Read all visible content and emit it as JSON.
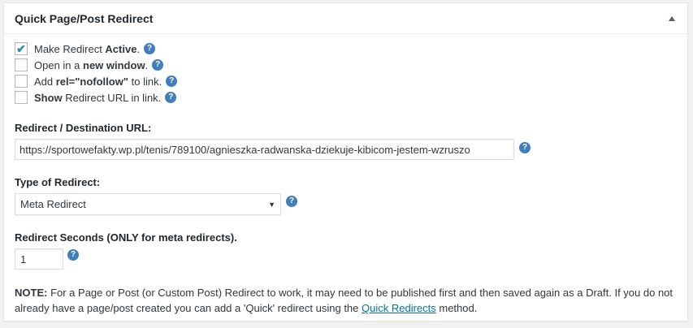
{
  "box": {
    "title": "Quick Page/Post Redirect"
  },
  "options": [
    {
      "checked": true,
      "pre": "Make Redirect ",
      "bold": "Active",
      "post": "."
    },
    {
      "checked": false,
      "pre": "Open in a ",
      "bold": "new window",
      "post": "."
    },
    {
      "checked": false,
      "pre": "Add ",
      "bold": "rel=\"nofollow\"",
      "post": " to link."
    },
    {
      "checked": false,
      "pre": "",
      "bold": "Show",
      "post": " Redirect URL in link."
    }
  ],
  "url_field": {
    "label": "Redirect / Destination URL:",
    "value": "https://sportowefakty.wp.pl/tenis/789100/agnieszka-radwanska-dziekuje-kibicom-jestem-wzruszo"
  },
  "type_field": {
    "label": "Type of Redirect:",
    "selected": "Meta Redirect"
  },
  "seconds_field": {
    "label": "Redirect Seconds (ONLY for meta redirects).",
    "value": "1"
  },
  "note": {
    "strong": "NOTE:",
    "text": " For a Page or Post (or Custom Post) Redirect to work, it may need to be published first and then saved again as a Draft. If you do not already have a page/post created you can add a 'Quick' redirect using the ",
    "link": "Quick Redirects",
    "after": " method."
  },
  "icons": {
    "help": "?",
    "check": "✔",
    "dropdown_arrow": "▼"
  },
  "colors": {
    "accent": "#1e8cbe",
    "help_icon": "#3f7fbd",
    "link": "#0073aa"
  }
}
